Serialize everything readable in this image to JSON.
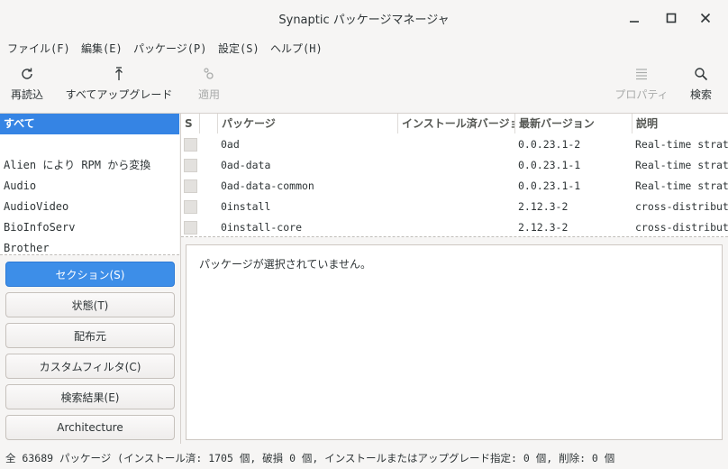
{
  "window": {
    "title": "Synaptic パッケージマネージャ"
  },
  "menu": [
    "ファイル(F)",
    "編集(E)",
    "パッケージ(P)",
    "設定(S)",
    "ヘルプ(H)"
  ],
  "toolbar": {
    "reload": "再読込",
    "upgrade_all": "すべてアップグレード",
    "apply": "適用",
    "properties": "プロパティ",
    "search": "検索"
  },
  "categories": [
    "すべて",
    "",
    "Alien により RPM から変換",
    "Audio",
    "AudioVideo",
    "BioInfoServ",
    "Brother"
  ],
  "filters": [
    "セクション(S)",
    "状態(T)",
    "配布元",
    "カスタムフィルタ(C)",
    "検索結果(E)",
    "Architecture"
  ],
  "columns": {
    "s": "S",
    "package": "パッケージ",
    "installed": "インストール済バージョン",
    "latest": "最新バージョン",
    "description": "説明"
  },
  "packages": [
    {
      "name": "0ad",
      "installed": "",
      "latest": "0.0.23.1-2",
      "description": "Real-time strategy"
    },
    {
      "name": "0ad-data",
      "installed": "",
      "latest": "0.0.23.1-1",
      "description": "Real-time strategy"
    },
    {
      "name": "0ad-data-common",
      "installed": "",
      "latest": "0.0.23.1-1",
      "description": "Real-time strategy"
    },
    {
      "name": "0install",
      "installed": "",
      "latest": "2.12.3-2",
      "description": "cross-distribution"
    },
    {
      "name": "0install-core",
      "installed": "",
      "latest": "2.12.3-2",
      "description": "cross-distribution"
    }
  ],
  "details": {
    "message": "パッケージが選択されていません。"
  },
  "status": "全 63689 パッケージ (インストール済: 1705 個, 破損 0 個, インストールまたはアップグレード指定: 0 個, 削除: 0 個"
}
